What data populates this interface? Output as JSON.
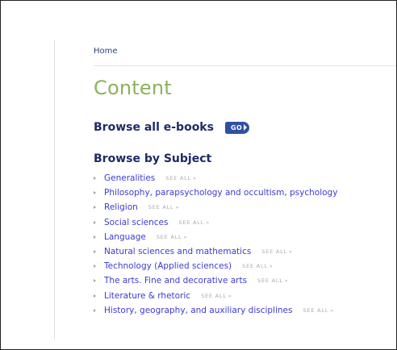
{
  "breadcrumb": {
    "home_label": "Home"
  },
  "page": {
    "title": "Content"
  },
  "browse_all": {
    "heading": "Browse all e-books",
    "go_label": "GO"
  },
  "browse_by_subject": {
    "heading": "Browse by Subject",
    "see_all_label": "SEE ALL",
    "see_all_chevron": "»",
    "items": [
      {
        "label": "Generalities",
        "see_all": true
      },
      {
        "label": "Philosophy, parapsychology and occultism, psychology",
        "see_all": false
      },
      {
        "label": "Religion",
        "see_all": true
      },
      {
        "label": "Social sciences",
        "see_all": true
      },
      {
        "label": "Language",
        "see_all": true
      },
      {
        "label": "Natural sciences and mathematics",
        "see_all": true
      },
      {
        "label": "Technology (Applied sciences)",
        "see_all": true
      },
      {
        "label": "The arts. Fine and decorative arts",
        "see_all": true
      },
      {
        "label": "Literature & rhetoric",
        "see_all": true
      },
      {
        "label": "History, geography, and auxiliary disciplines",
        "see_all": true
      }
    ]
  },
  "colors": {
    "title_green": "#8bb35a",
    "heading_navy": "#1f2a66",
    "link_blue": "#3d3ad0",
    "go_button_blue": "#2e51a3",
    "see_all_gray": "#a8a8b2"
  }
}
